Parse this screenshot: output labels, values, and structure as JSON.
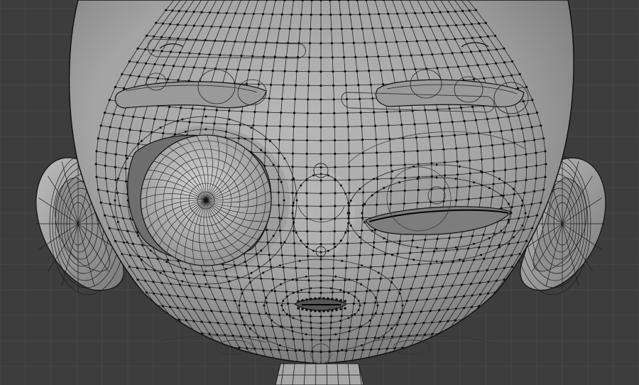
{
  "viewport": {
    "name": "3d-viewport-wireframe-head",
    "background": "#3d3d3d",
    "grid_color": "#484848",
    "mesh_fill": "#9c9c9c",
    "wire_color": "#1a1a1a",
    "vertex_color": "#0d0d0d",
    "elements": [
      "grid",
      "head-mesh",
      "left-ear",
      "right-ear",
      "left-eyebrow",
      "right-eyebrow",
      "left-eye-open",
      "right-eye-closed",
      "nose",
      "mouth",
      "neck"
    ]
  }
}
